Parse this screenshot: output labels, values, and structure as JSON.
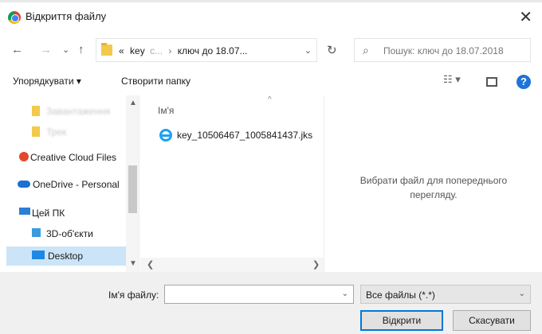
{
  "window": {
    "title": "Відкриття файлу",
    "close_glyph": "✕"
  },
  "nav": {
    "back": "←",
    "forward": "→",
    "recent": "⌄",
    "up": "↑",
    "breadcrumb": {
      "prefix": "«",
      "crumb1": "key",
      "crumb1_faded": "с...",
      "separator": "›",
      "crumb2": "ключ до 18.07...",
      "dropdown": "⌄"
    },
    "refresh": "↻",
    "search_placeholder": "Пошук: ключ до 18.07.2018",
    "search_icon": "⌕"
  },
  "toolbar": {
    "organize": "Упорядкувати ▾",
    "new_folder": "Створити папку",
    "view_glyph": "☷ ▾",
    "help": "?"
  },
  "sidebar": {
    "items": [
      {
        "label": "Завантаження",
        "icon": "folder-icon",
        "blurred": true
      },
      {
        "label": "Трек",
        "icon": "folder-icon",
        "blurred": true
      },
      {
        "label": "Creative Cloud Files",
        "icon": "creative-cloud-icon"
      },
      {
        "label": "OneDrive - Personal",
        "icon": "onedrive-icon"
      },
      {
        "label": "Цей ПК",
        "icon": "computer-icon"
      },
      {
        "label": "3D-об'єкти",
        "icon": "3d-objects-icon"
      },
      {
        "label": "Desktop",
        "icon": "desktop-icon",
        "selected": true
      }
    ]
  },
  "files": {
    "column_name": "Ім'я",
    "sort_glyph": "^",
    "items": [
      {
        "name": "key_10506467_1005841437.jks",
        "icon": "ie-file-icon"
      }
    ]
  },
  "preview": {
    "message": "Вибрати файл для попереднього перегляду."
  },
  "footer": {
    "filename_label": "Ім'я файлу:",
    "filename_value": "",
    "filetype": "Все файлы (*.*)",
    "open": "Відкрити",
    "cancel": "Скасувати"
  },
  "colors": {
    "accent": "#0078d7",
    "selection": "#cce4f7",
    "folder": "#f2c94c"
  }
}
